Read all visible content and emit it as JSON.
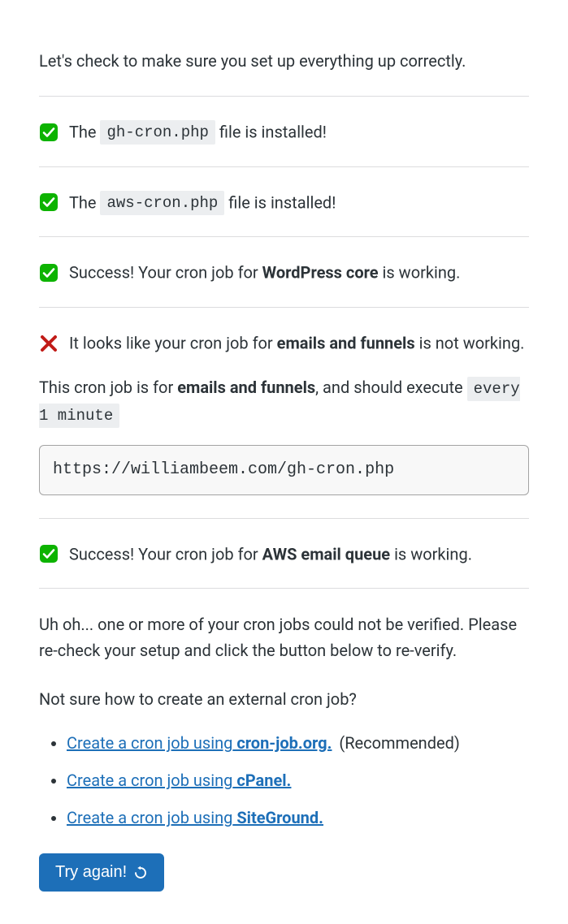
{
  "intro": "Let's check to make sure you set up everything up correctly.",
  "checks": {
    "gh_cron": {
      "prefix": "The ",
      "code": "gh-cron.php",
      "suffix": " file is installed!"
    },
    "aws_cron": {
      "prefix": "The ",
      "code": "aws-cron.php",
      "suffix": " file is installed!"
    },
    "wp_core": {
      "prefix": "Success! Your cron job for ",
      "bold": "WordPress core",
      "suffix": " is working."
    },
    "emails_funnels_fail": {
      "line1_prefix": "It looks like your cron job for ",
      "line1_bold": "emails and funnels",
      "line1_suffix": " is not working.",
      "line2_prefix": "This cron job is for ",
      "line2_bold": "emails and funnels",
      "line2_mid": ", and should execute ",
      "line2_code": "every 1 minute",
      "url": "https://williambeem.com/gh-cron.php"
    },
    "aws_queue": {
      "prefix": "Success! Your cron job for ",
      "bold": "AWS email queue",
      "suffix": " is working."
    }
  },
  "footer": {
    "warning": "Uh oh... one or more of your cron jobs could not be verified. Please re-check your setup and click the button below to re-verify.",
    "help_heading": "Not sure how to create an external cron job?",
    "links": {
      "item1_prefix": "Create a cron job using",
      "item1_strong": " cron-job.org.",
      "item1_recommended": "(Recommended)",
      "item2_prefix": "Create a cron job using",
      "item2_strong": " cPanel.",
      "item3_prefix": "Create a cron job using",
      "item3_strong": " SiteGround."
    },
    "button_label": "Try again!"
  }
}
